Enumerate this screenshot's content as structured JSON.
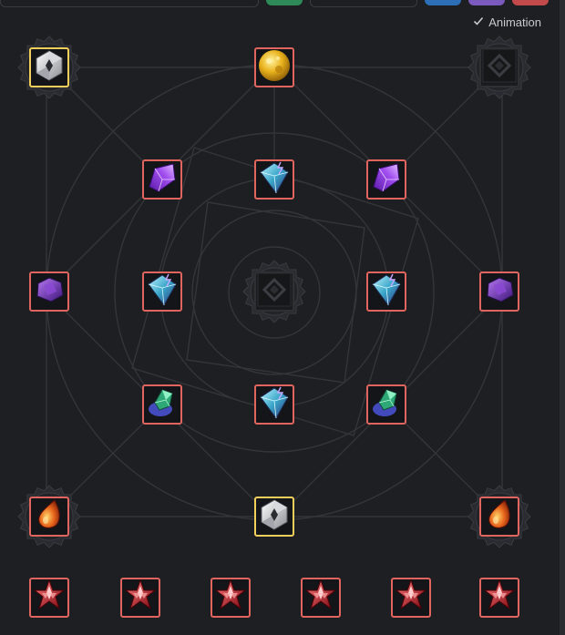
{
  "toolbar": {
    "animation_label": "Animation",
    "animation_checked": true,
    "colors": {
      "green": "#2e8b57",
      "blue": "#2d6fb6",
      "purple": "#7a5bbd",
      "red": "#c24a4a"
    }
  },
  "theme": {
    "slot_border": "#e0655e",
    "slot_border_special": "#f2cf5b"
  },
  "nodes": [
    {
      "id": "corner-top-left",
      "icon": "white-crystal-icon",
      "border": "gold",
      "halo": true
    },
    {
      "id": "top-center",
      "icon": "gold-ore-icon",
      "border": "red",
      "halo": false
    },
    {
      "id": "corner-top-right",
      "icon": "locked-slot-icon",
      "border": "empty",
      "halo": true
    },
    {
      "id": "inner-top-left",
      "icon": "purple-shard-icon",
      "border": "red",
      "halo": false
    },
    {
      "id": "inner-top-center",
      "icon": "lightning-crystal-icon",
      "border": "red",
      "halo": false
    },
    {
      "id": "inner-top-right",
      "icon": "purple-shard-icon",
      "border": "red",
      "halo": false
    },
    {
      "id": "mid-left",
      "icon": "amethyst-gem-icon",
      "border": "red",
      "halo": false
    },
    {
      "id": "inner-mid-left",
      "icon": "lightning-crystal-icon",
      "border": "red",
      "halo": false
    },
    {
      "id": "center",
      "icon": "locked-slot-icon",
      "border": "empty",
      "halo": true
    },
    {
      "id": "inner-mid-right",
      "icon": "lightning-crystal-icon",
      "border": "red",
      "halo": false
    },
    {
      "id": "mid-right",
      "icon": "amethyst-gem-icon",
      "border": "red",
      "halo": false
    },
    {
      "id": "inner-bottom-left",
      "icon": "emerald-shard-icon",
      "border": "red",
      "halo": false
    },
    {
      "id": "inner-bottom-center",
      "icon": "lightning-crystal-icon",
      "border": "red",
      "halo": false
    },
    {
      "id": "inner-bottom-right",
      "icon": "emerald-shard-icon",
      "border": "red",
      "halo": false
    },
    {
      "id": "corner-bottom-left",
      "icon": "fire-drop-icon",
      "border": "red",
      "halo": true
    },
    {
      "id": "bottom-center",
      "icon": "white-crystal-icon",
      "border": "gold",
      "halo": false
    },
    {
      "id": "corner-bottom-right",
      "icon": "fire-drop-icon",
      "border": "red",
      "halo": true
    }
  ],
  "inventory": [
    {
      "icon": "ruby-star-icon"
    },
    {
      "icon": "ruby-star-icon"
    },
    {
      "icon": "ruby-star-icon"
    },
    {
      "icon": "ruby-star-icon"
    },
    {
      "icon": "ruby-star-icon"
    },
    {
      "icon": "ruby-star-icon"
    }
  ]
}
